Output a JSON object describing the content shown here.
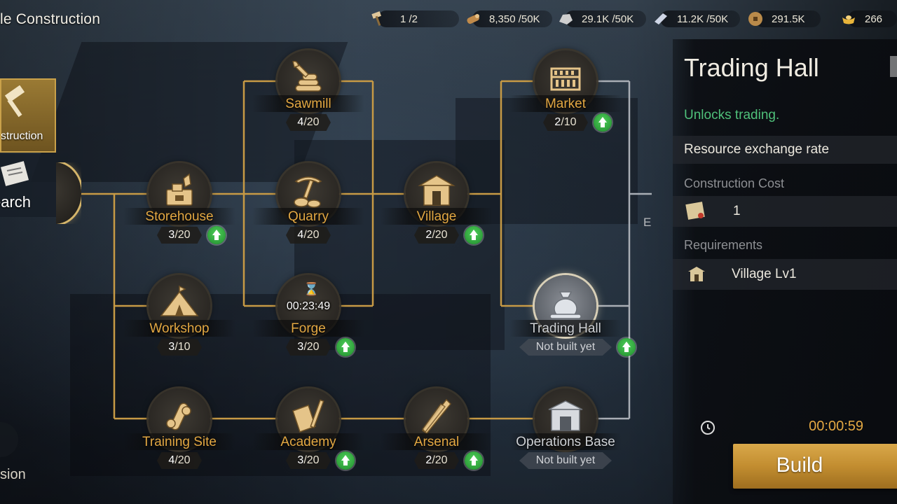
{
  "screen": {
    "title": "le Construction"
  },
  "resources": [
    {
      "id": "hammer",
      "icon": "hammer-icon",
      "value": "1 /2"
    },
    {
      "id": "wood",
      "icon": "wood-log-icon",
      "value": "8,350 /50K"
    },
    {
      "id": "stone",
      "icon": "stone-icon",
      "value": "29.1K /50K"
    },
    {
      "id": "iron",
      "icon": "iron-ingot-icon",
      "value": "11.2K /50K"
    },
    {
      "id": "coin",
      "icon": "coin-icon",
      "value": "291.5K"
    },
    {
      "id": "gold",
      "icon": "gold-ingot-icon",
      "value": "266"
    }
  ],
  "side_tabs": {
    "construction": "nstruction",
    "research": "search",
    "mission": "ssion"
  },
  "nodes": {
    "sawmill": {
      "name": "Sawmill",
      "current": "4",
      "max": "/20"
    },
    "market": {
      "name": "Market",
      "current": "2",
      "max": "/10"
    },
    "storehouse": {
      "name": "Storehouse",
      "current": "3",
      "max": "/20"
    },
    "quarry": {
      "name": "Quarry",
      "current": "4",
      "max": "/20"
    },
    "village": {
      "name": "Village",
      "current": "2",
      "max": "/20"
    },
    "workshop": {
      "name": "Workshop",
      "current": "3",
      "max": "/10"
    },
    "forge": {
      "name": "Forge",
      "current": "3",
      "max": "/20",
      "timer": "00:23:49"
    },
    "trading_hall": {
      "name": "Trading Hall",
      "status": "Not built yet"
    },
    "training_site": {
      "name": "Training Site",
      "current": "4",
      "max": "/20"
    },
    "academy": {
      "name": "Academy",
      "current": "3",
      "max": "/20"
    },
    "arsenal": {
      "name": "Arsenal",
      "current": "2",
      "max": "/20"
    },
    "operations_base": {
      "name": "Operations Base",
      "status": "Not built yet"
    }
  },
  "stray_letter": "E",
  "panel": {
    "title": "Trading Hall",
    "description": "Unlocks trading.",
    "effect": "Resource exchange rate",
    "cost_heading": "Construction Cost",
    "cost_value": "1",
    "requirements_heading": "Requirements",
    "requirement": "Village Lv1",
    "build_time": "00:00:59",
    "build_label": "Build"
  },
  "colors": {
    "accent_gold": "#e3a843",
    "positive_green": "#4fc07a",
    "line_gold": "#c79a45"
  }
}
